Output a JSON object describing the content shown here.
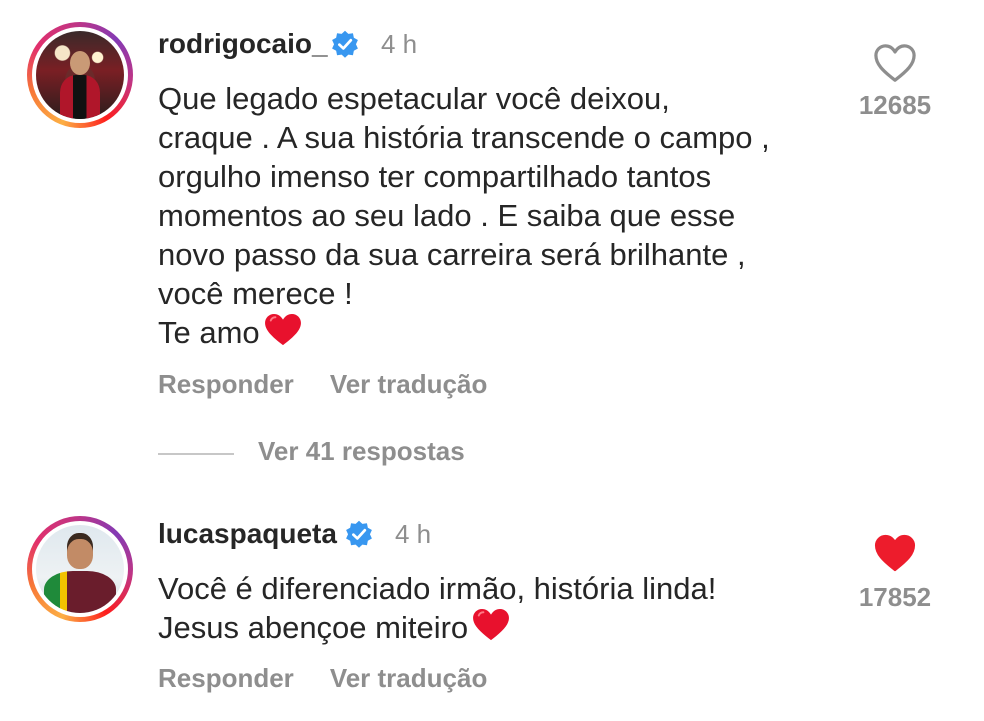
{
  "comments": [
    {
      "username": "rodrigocaio_",
      "time": "4 h",
      "text_lines": [
        "Que legado espetacular você deixou,",
        "craque . A sua história transcende o campo ,",
        "orgulho imenso ter compartilhado tantos",
        "momentos ao seu lado . E saiba que esse",
        "novo passo da sua carreira será brilhante ,",
        "você merece !",
        "Te amo"
      ],
      "likes": "12685",
      "liked": false,
      "reply_label": "Responder",
      "translate_label": "Ver tradução",
      "view_replies_label": "Ver 41 respostas"
    },
    {
      "username": "lucaspaqueta",
      "time": "4 h",
      "text_lines": [
        "Você é diferenciado irmão, história linda!",
        "Jesus abençoe miteiro"
      ],
      "likes": "17852",
      "liked": true,
      "reply_label": "Responder",
      "translate_label": "Ver tradução"
    }
  ],
  "icons": {
    "verified": "verified-badge-icon",
    "like_empty": "heart-outline-icon",
    "like_filled": "heart-filled-icon",
    "emoji": "red-heart-emoji"
  },
  "colors": {
    "text": "#262626",
    "muted": "#8e8e8e",
    "verified_blue": "#3897f0",
    "heart_red": "#ed1c2c"
  }
}
